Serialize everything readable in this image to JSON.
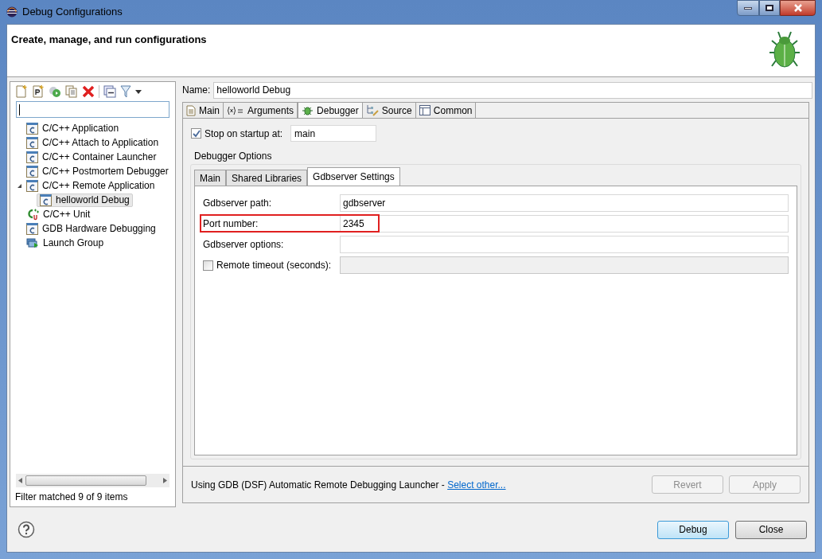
{
  "window": {
    "title": "Debug Configurations"
  },
  "header": {
    "title": "Create, manage, and run configurations"
  },
  "tree": [
    {
      "label": "C/C++ Application",
      "kind": "c",
      "selected": false
    },
    {
      "label": "C/C++ Attach to Application",
      "kind": "c",
      "selected": false
    },
    {
      "label": "C/C++ Container Launcher",
      "kind": "c",
      "selected": false
    },
    {
      "label": "C/C++ Postmortem Debugger",
      "kind": "c",
      "selected": false
    },
    {
      "label": "C/C++ Remote Application",
      "kind": "c",
      "selected": false,
      "expanded": true,
      "children": [
        {
          "label": "helloworld Debug",
          "kind": "c",
          "selected": true
        }
      ]
    },
    {
      "label": "C/C++ Unit",
      "kind": "unit",
      "selected": false
    },
    {
      "label": "GDB Hardware Debugging",
      "kind": "c",
      "selected": false
    },
    {
      "label": "Launch Group",
      "kind": "group",
      "selected": false
    }
  ],
  "filter_status": "Filter matched 9 of 9 items",
  "name": {
    "label": "Name:",
    "value": "helloworld Debug"
  },
  "tabs": [
    {
      "label": "Main",
      "kind": "doc",
      "selected": false
    },
    {
      "label": "Arguments",
      "kind": "args",
      "selected": false
    },
    {
      "label": "Debugger",
      "kind": "bug",
      "selected": true
    },
    {
      "label": "Source",
      "kind": "source",
      "selected": false
    },
    {
      "label": "Common",
      "kind": "table",
      "selected": false
    }
  ],
  "stop_on_startup": {
    "label": "Stop on startup at:",
    "checked": true,
    "value": "main"
  },
  "debugger_options": {
    "title": "Debugger Options",
    "tabs": [
      {
        "label": "Main",
        "selected": false
      },
      {
        "label": "Shared Libraries",
        "selected": false
      },
      {
        "label": "Gdbserver Settings",
        "selected": true
      }
    ],
    "rows": [
      {
        "kind": "text",
        "label": "Gdbserver path:",
        "value": "gdbserver",
        "highlighted": false
      },
      {
        "kind": "text",
        "label": "Port number:",
        "value": "2345",
        "highlighted": true
      },
      {
        "kind": "text",
        "label": "Gdbserver options:",
        "highlighted": false
      },
      {
        "kind": "checkbox",
        "label": "Remote timeout (seconds):",
        "checked": false,
        "disabled": true,
        "highlighted": false
      }
    ]
  },
  "launcher": {
    "text": "Using GDB (DSF) Automatic Remote Debugging Launcher - ",
    "link": "Select other..."
  },
  "panel_buttons": [
    {
      "label": "Revert",
      "disabled": true
    },
    {
      "label": "Apply",
      "disabled": true
    }
  ],
  "dialog_buttons": [
    {
      "label": "Debug",
      "default": true
    },
    {
      "label": "Close",
      "default": false
    }
  ]
}
